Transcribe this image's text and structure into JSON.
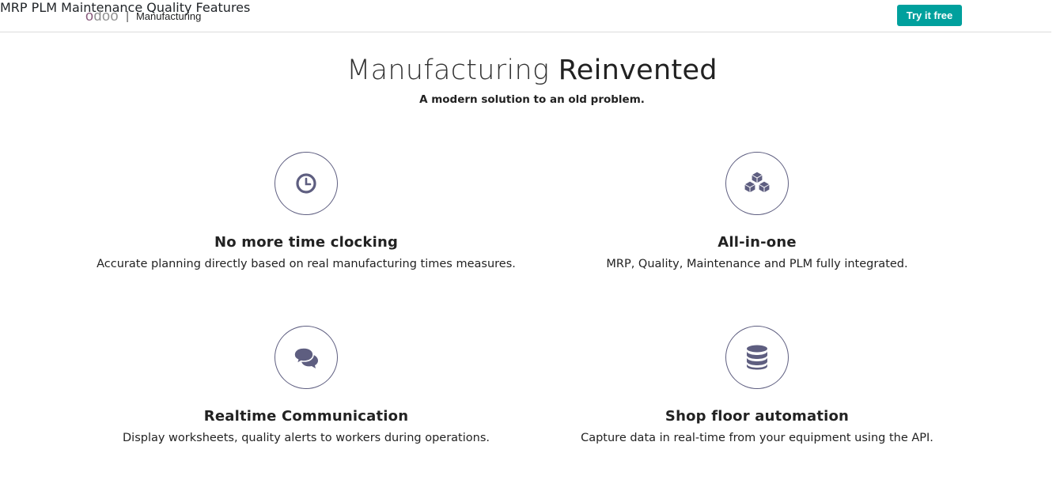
{
  "nav": {
    "logo": "odoo",
    "separator": "|",
    "product": "Manufacturing",
    "links": [
      "MRP",
      "PLM",
      "Maintenance",
      "Quality",
      "Features"
    ],
    "cta_label": "Try it free",
    "cta_color": "#00a09d"
  },
  "hero": {
    "title_light": "Manufacturing",
    "title_strong": "Reinvented",
    "subtitle": "A modern solution to an old problem."
  },
  "features": [
    {
      "icon": "clock-icon",
      "title": "No more time clocking",
      "description": "Accurate planning directly based on real manufacturing times measures."
    },
    {
      "icon": "cubes-icon",
      "title": "All-in-one",
      "description": "MRP, Quality, Maintenance and PLM fully integrated."
    },
    {
      "icon": "chat-bubbles-icon",
      "title": "Realtime Communication",
      "description": "Display worksheets, quality alerts to workers during operations."
    },
    {
      "icon": "database-icon",
      "title": "Shop floor automation",
      "description": "Capture data in real-time from your equipment using the API."
    }
  ],
  "colors": {
    "icon": "#5e5e80",
    "logo_accent": "#875a7b"
  }
}
